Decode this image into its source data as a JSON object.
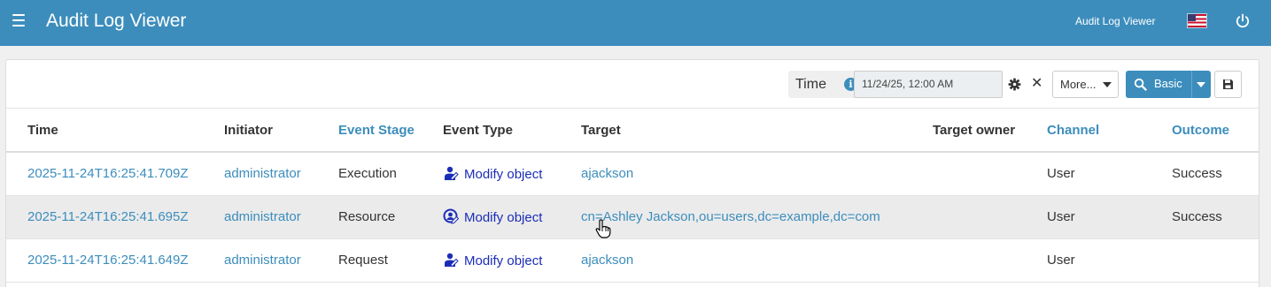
{
  "header": {
    "title": "Audit Log Viewer",
    "app_link": "Audit Log Viewer",
    "menu_icon": "hamburger-menu-icon",
    "language_icon": "us-flag-icon",
    "logout_icon": "power-icon"
  },
  "toolbar": {
    "time_label": "Time",
    "time_value": "11/24/25, 12:00 AM",
    "more_label": "More...",
    "search_label": "Basic"
  },
  "table": {
    "columns": [
      {
        "label": "Time",
        "sortable": false
      },
      {
        "label": "Initiator",
        "sortable": false
      },
      {
        "label": "Event Stage",
        "sortable": true
      },
      {
        "label": "Event Type",
        "sortable": false
      },
      {
        "label": "Target",
        "sortable": false
      },
      {
        "label": "Target owner",
        "sortable": false
      },
      {
        "label": "Channel",
        "sortable": true
      },
      {
        "label": "Outcome",
        "sortable": true
      }
    ],
    "rows": [
      {
        "time": "2025-11-24T16:25:41.709Z",
        "initiator": "administrator",
        "stage": "Execution",
        "event_type": "Modify object",
        "event_icon": "user-edit-icon",
        "target": "ajackson",
        "target_owner": "",
        "channel": "User",
        "outcome": "Success"
      },
      {
        "time": "2025-11-24T16:25:41.695Z",
        "initiator": "administrator",
        "stage": "Resource",
        "event_type": "Modify object",
        "event_icon": "resource-edit-icon",
        "target": "cn=Ashley Jackson,ou=users,dc=example,dc=com",
        "target_owner": "",
        "channel": "User",
        "outcome": "Success"
      },
      {
        "time": "2025-11-24T16:25:41.649Z",
        "initiator": "administrator",
        "stage": "Request",
        "event_type": "Modify object",
        "event_icon": "user-edit-icon",
        "target": "ajackson",
        "target_owner": "",
        "channel": "User",
        "outcome": ""
      }
    ]
  },
  "colors": {
    "header_bg": "#3c8dbc",
    "link": "#3c8dbc",
    "event_link": "#1b2db8",
    "stripe": "#ebebeb"
  }
}
